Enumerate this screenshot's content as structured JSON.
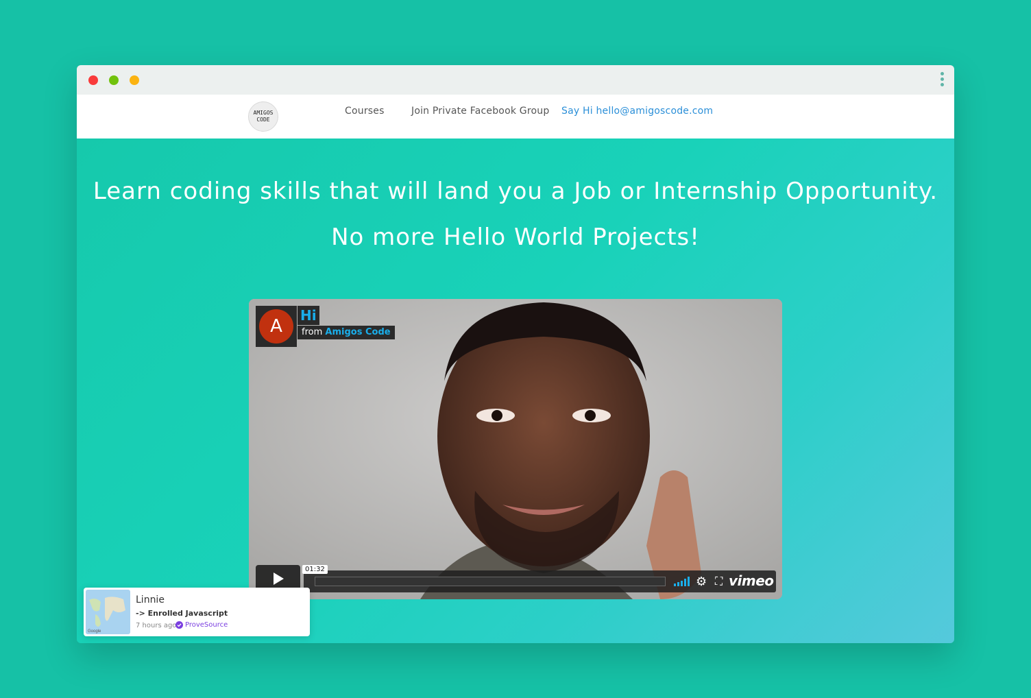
{
  "window": {
    "controls": [
      "close",
      "minimize",
      "maximize"
    ]
  },
  "nav": {
    "logo_line1": "AMIGOS",
    "logo_line2": "CODE",
    "courses": "Courses",
    "facebook": "Join Private Facebook Group",
    "contact": "Say Hi hello@amigoscode.com"
  },
  "hero": {
    "line1": "Learn coding skills that will land you a Job or Internship Opportunity.",
    "line2": "No more Hello World Projects!"
  },
  "video": {
    "avatar_letter": "A",
    "greeting": "Hi",
    "from_label": "from",
    "from_name": "Amigos Code",
    "timecode": "01:32",
    "brand": "vimeo",
    "icons": [
      "play-icon",
      "volume-icon",
      "settings-icon",
      "fullscreen-icon"
    ]
  },
  "toast": {
    "name": "Linnie",
    "action": "-> Enrolled Javascript",
    "time": "7 hours ago",
    "verified_by": "ProveSource",
    "map_label": "Google"
  },
  "colors": {
    "background": "#16c1a6",
    "accent_blue": "#1aaeea",
    "link_blue": "#2b8fd8",
    "verify_purple": "#7a3ee0",
    "avatar_red": "#c1310f"
  }
}
